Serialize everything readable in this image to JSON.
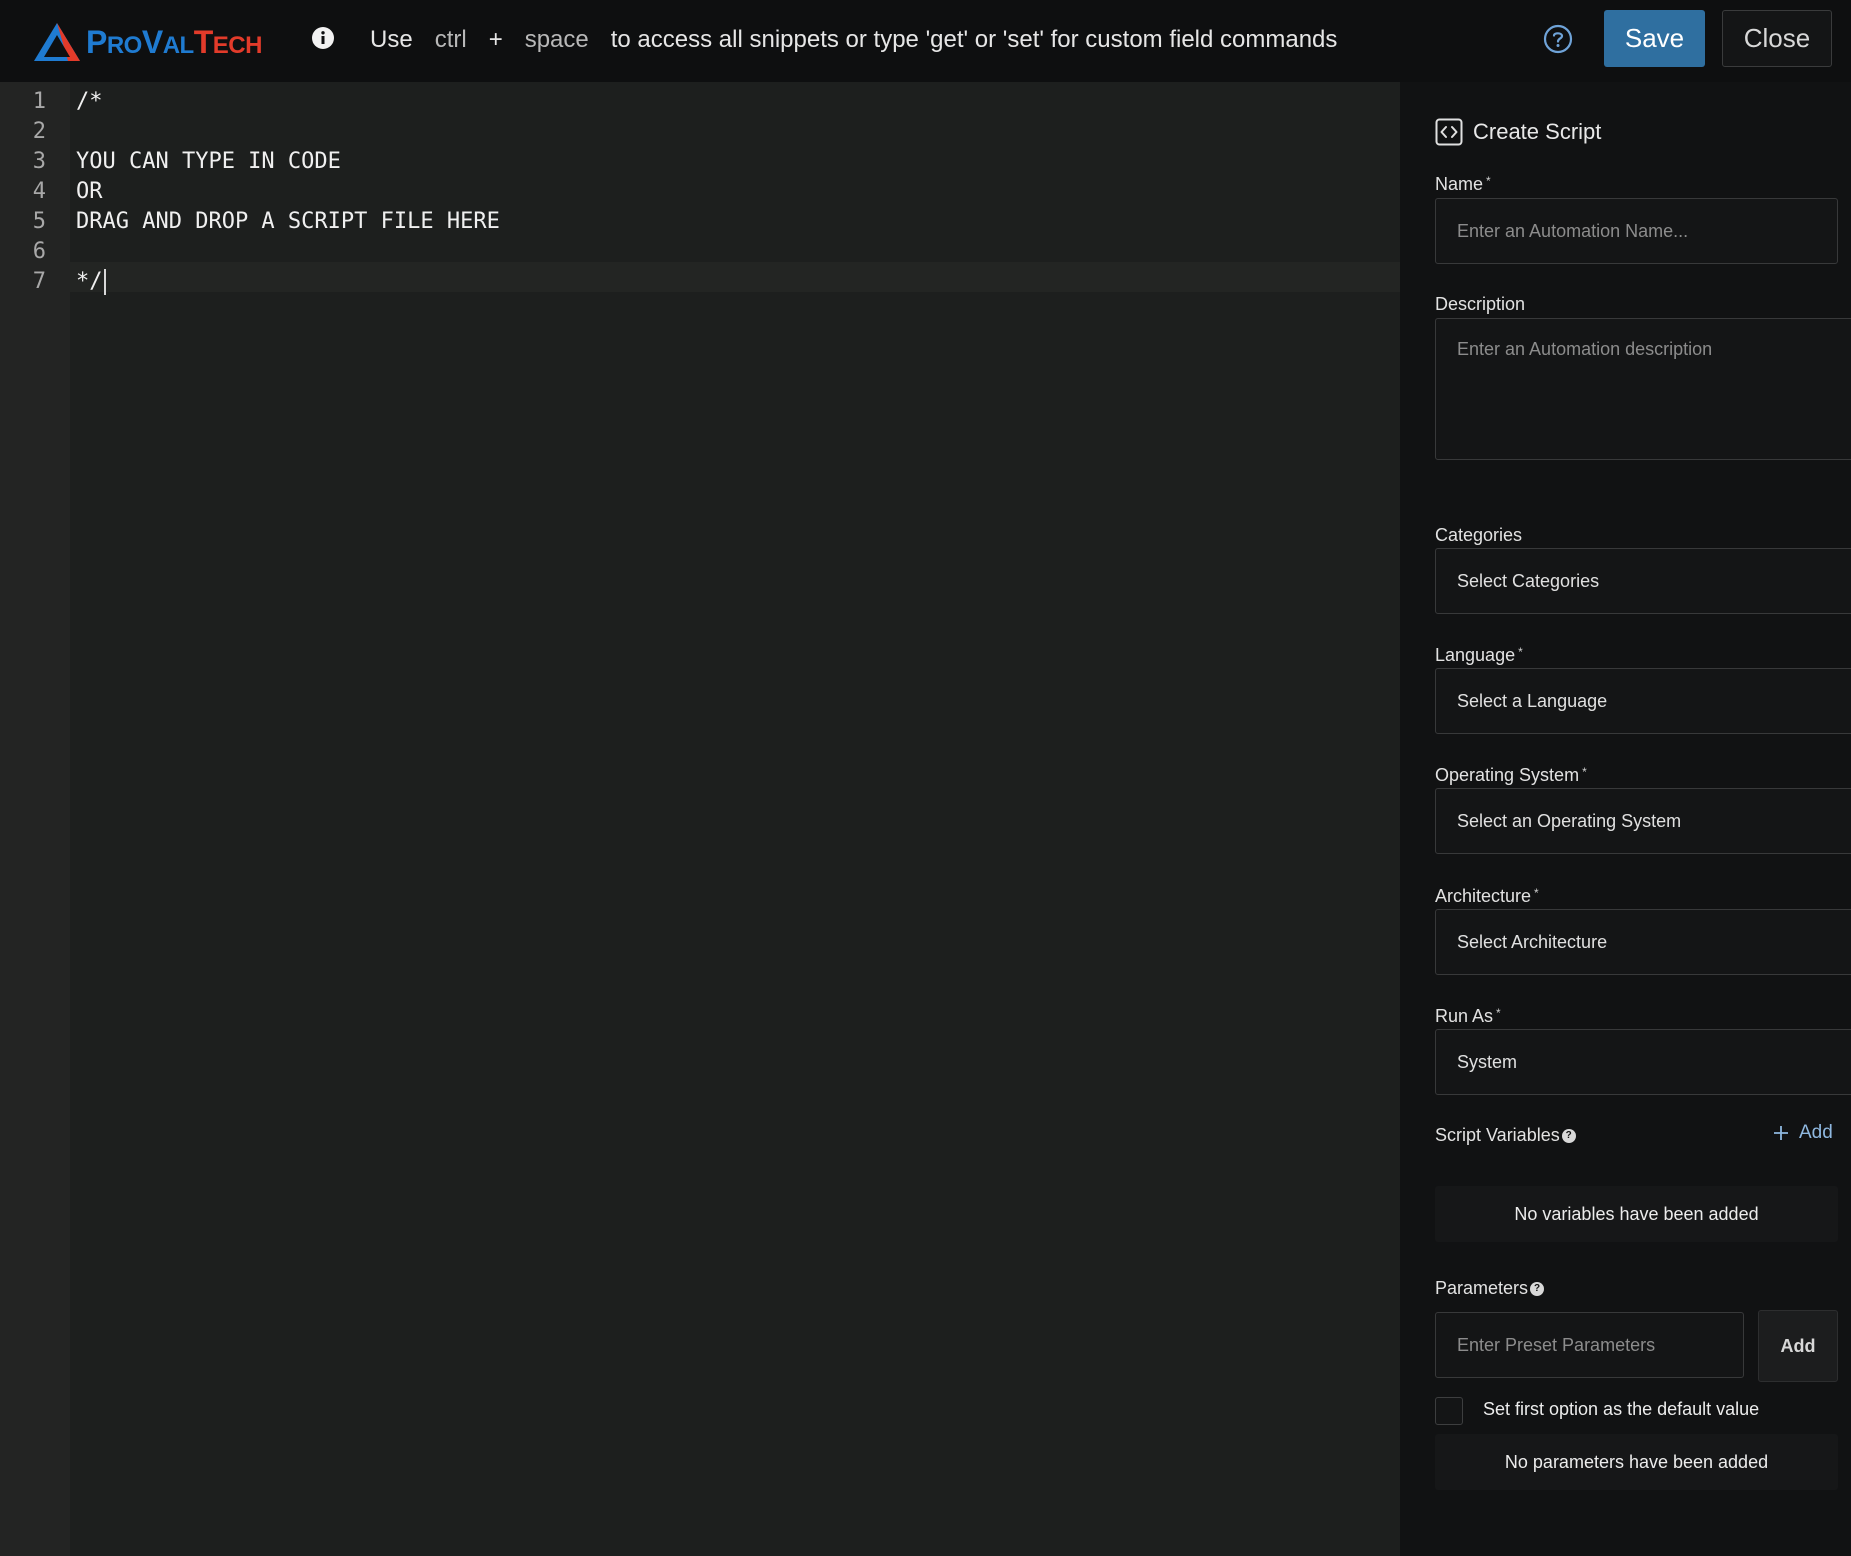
{
  "header": {
    "logo_text": "ProValTech",
    "hint": {
      "use": "Use",
      "key1": "ctrl",
      "plus": "+",
      "key2": "space",
      "rest": "to access all snippets or type 'get' or 'set' for custom field commands"
    },
    "save_label": "Save",
    "close_label": "Close",
    "icons": [
      "info-icon",
      "help-icon"
    ]
  },
  "editor": {
    "lines": [
      {
        "no": "1",
        "text": "/*"
      },
      {
        "no": "2",
        "text": ""
      },
      {
        "no": "3",
        "text": "YOU CAN TYPE IN CODE"
      },
      {
        "no": "4",
        "text": "OR"
      },
      {
        "no": "5",
        "text": "DRAG AND DROP A SCRIPT FILE HERE"
      },
      {
        "no": "6",
        "text": ""
      },
      {
        "no": "7",
        "text": "*/"
      }
    ]
  },
  "panel": {
    "title": "Create Script",
    "name": {
      "label": "Name",
      "required": "*",
      "placeholder": "Enter an Automation Name..."
    },
    "description": {
      "label": "Description",
      "placeholder": "Enter an Automation description"
    },
    "categories": {
      "label": "Categories",
      "value": "Select Categories"
    },
    "language": {
      "label": "Language",
      "required": "*",
      "value": "Select a Language"
    },
    "os": {
      "label": "Operating System",
      "required": "*",
      "value": "Select an Operating System"
    },
    "architecture": {
      "label": "Architecture",
      "required": "*",
      "value": "Select Architecture"
    },
    "run_as": {
      "label": "Run As",
      "required": "*",
      "value": "System"
    },
    "script_variables": {
      "label": "Script Variables",
      "help": "?",
      "add_label": "Add",
      "empty_text": "No variables have been added"
    },
    "parameters": {
      "label": "Parameters",
      "help": "?",
      "placeholder": "Enter Preset Parameters",
      "add_label": "Add",
      "checkbox_label": "Set first option as the default value",
      "empty_text": "No parameters have been added"
    }
  },
  "colors": {
    "accent": "#2f6fa0",
    "logo_blue": "#1f7bd1",
    "logo_red": "#e23b2a",
    "link": "#8fb8e0"
  }
}
